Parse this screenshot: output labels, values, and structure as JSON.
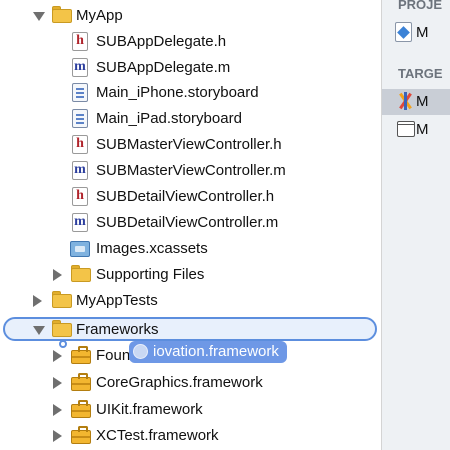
{
  "navigator": {
    "rows": [
      {
        "label": "MyApp",
        "icon": "folder-icon",
        "disclosure": "expanded"
      },
      {
        "label": "SUBAppDelegate.h",
        "icon": "header-file-icon"
      },
      {
        "label": "SUBAppDelegate.m",
        "icon": "implementation-file-icon"
      },
      {
        "label": "Main_iPhone.storyboard",
        "icon": "storyboard-file-icon"
      },
      {
        "label": "Main_iPad.storyboard",
        "icon": "storyboard-file-icon"
      },
      {
        "label": "SUBMasterViewController.h",
        "icon": "header-file-icon"
      },
      {
        "label": "SUBMasterViewController.m",
        "icon": "implementation-file-icon"
      },
      {
        "label": "SUBDetailViewController.h",
        "icon": "header-file-icon"
      },
      {
        "label": "SUBDetailViewController.m",
        "icon": "implementation-file-icon"
      },
      {
        "label": "Images.xcassets",
        "icon": "asset-catalog-icon"
      },
      {
        "label": "Supporting Files",
        "icon": "folder-icon",
        "disclosure": "collapsed"
      },
      {
        "label": "MyAppTests",
        "icon": "folder-icon",
        "disclosure": "collapsed"
      },
      {
        "label": "Frameworks",
        "icon": "folder-icon",
        "disclosure": "expanded",
        "selected": true
      },
      {
        "label": "Foundation.framework",
        "icon": "framework-icon",
        "disclosure": "collapsed"
      },
      {
        "label": "CoreGraphics.framework",
        "icon": "framework-icon",
        "disclosure": "collapsed"
      },
      {
        "label": "UIKit.framework",
        "icon": "framework-icon",
        "disclosure": "collapsed"
      },
      {
        "label": "XCTest.framework",
        "icon": "framework-icon",
        "disclosure": "collapsed"
      }
    ],
    "drag_item": {
      "label": "iovation.framework"
    }
  },
  "side_panel": {
    "project_heading": "PROJE",
    "project_item": "M",
    "targets_heading": "TARGE",
    "target_items": [
      "M",
      "M"
    ]
  },
  "colors": {
    "selection_border": "#5c8ede",
    "drag_badge": "#6e98e6",
    "folder": "#f3c448"
  }
}
